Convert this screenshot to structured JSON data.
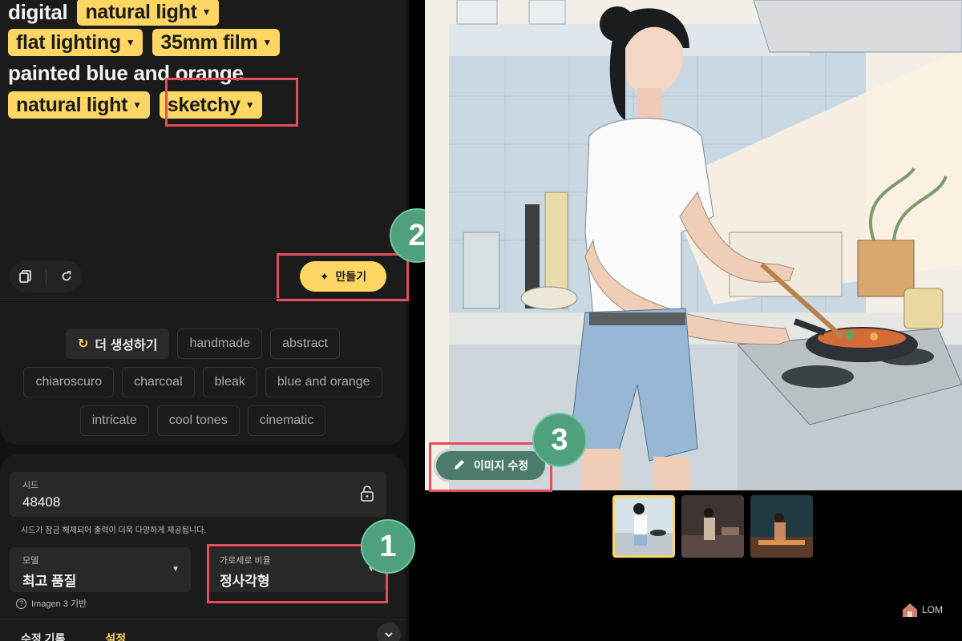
{
  "prompt": {
    "line1": {
      "word": "digital",
      "chip": "natural light"
    },
    "line2": {
      "chip1": "flat lighting",
      "chip2": "35mm film"
    },
    "line3": {
      "text": "painted blue and orange"
    },
    "line4": {
      "chip1": "natural light",
      "chip2": "sketchy"
    }
  },
  "toolbar": {
    "copy_icon": "copy-icon",
    "reset_icon": "refresh-icon",
    "create_label": "만들기"
  },
  "suggestions": {
    "more_label": "더 생성하기",
    "row1": [
      "handmade",
      "abstract"
    ],
    "row2": [
      "chiaroscuro",
      "charcoal",
      "bleak",
      "blue and orange"
    ],
    "row3": [
      "intricate",
      "cool tones",
      "cinematic"
    ]
  },
  "settings": {
    "seed_label": "시드",
    "seed_value": "48408",
    "seed_helper": "시드가 잠금 해제되어 출력이 더욱 다양하게 제공됩니다.",
    "model_label": "모델",
    "model_value": "최고 품질",
    "aspect_label": "가로세로 비율",
    "aspect_value": "정사각형",
    "model_note": "Imagen 3 기반",
    "tab_history": "수정 기록",
    "tab_settings": "설정"
  },
  "preview": {
    "edit_label": "이미지 수정"
  },
  "badges": {
    "one": "1",
    "two": "2",
    "three": "3"
  },
  "logo": {
    "text": "LOM"
  },
  "colors": {
    "accent": "#fdd663",
    "badge": "#4fa07c",
    "highlight": "#e44d5a",
    "edit_button": "#4c7b6d"
  }
}
